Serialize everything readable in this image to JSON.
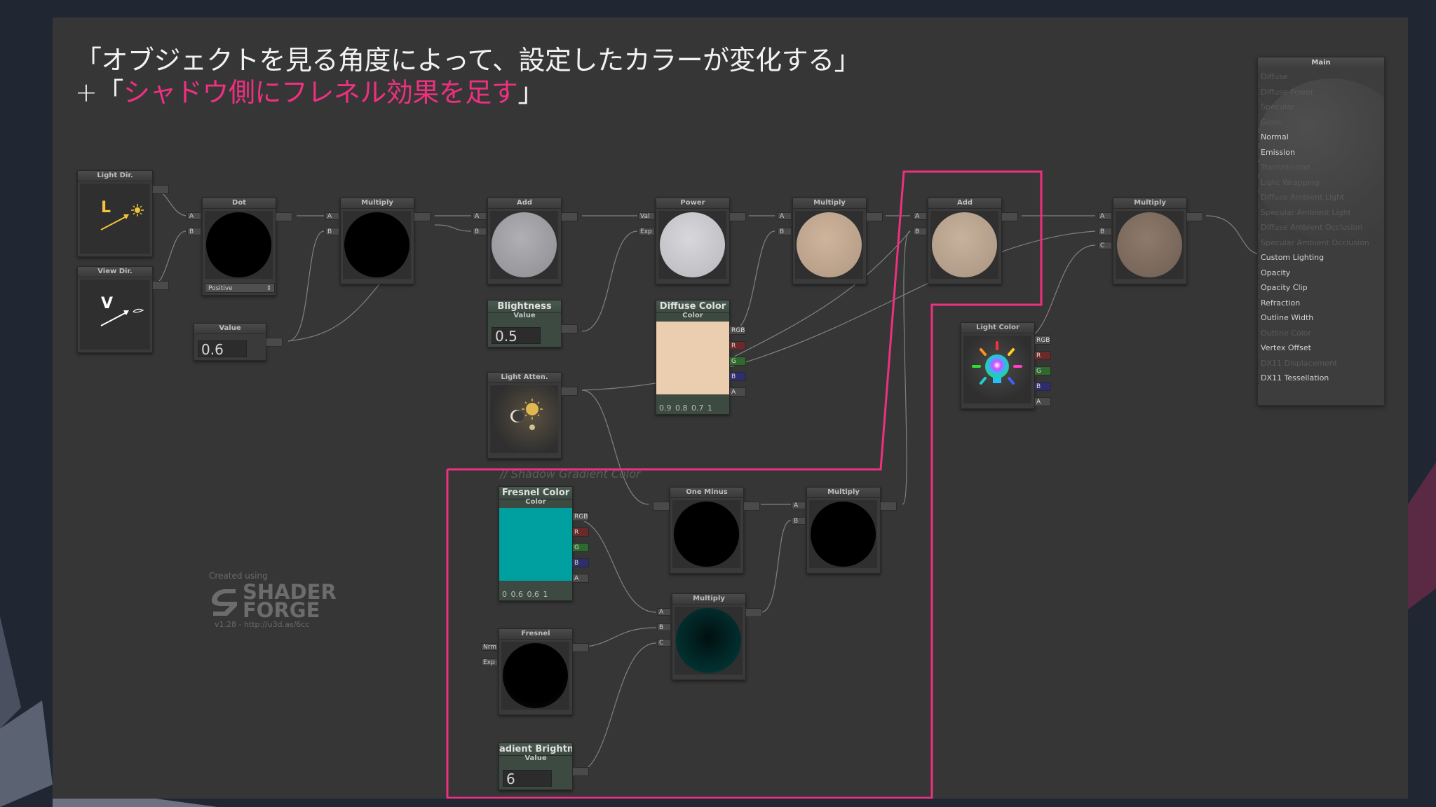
{
  "headline": {
    "line1": "「オブジェクトを見る角度によって、設定したカラーが変化する」",
    "line2_prefix": "+「",
    "line2_highlight": "シャドウ側にフレネル効果を足す",
    "line2_suffix": "」"
  },
  "nodes": {
    "light_dir": {
      "title": "Light Dir.",
      "glyph": "L"
    },
    "view_dir": {
      "title": "View Dir.",
      "glyph": "V"
    },
    "dot": {
      "title": "Dot",
      "port_a": "A",
      "port_b": "B",
      "mode": "Positive"
    },
    "value1": {
      "title": "Value",
      "value": "0.6"
    },
    "multiply1": {
      "title": "Multiply",
      "port_a": "A",
      "port_b": "B"
    },
    "add1": {
      "title": "Add",
      "port_a": "A",
      "port_b": "B"
    },
    "blightness": {
      "title": "Blightness",
      "sub": "Value",
      "value": "0.5"
    },
    "light_atten": {
      "title": "Light Atten."
    },
    "power": {
      "title": "Power",
      "port_val": "Val",
      "port_exp": "Exp"
    },
    "diffuse_color": {
      "title": "Diffuse Color",
      "sub": "Color",
      "swatch": "#ebcdb0",
      "rgba_text": "0.9  0.8  0.7  1",
      "ports": [
        "RGB",
        "R",
        "G",
        "B",
        "A"
      ]
    },
    "multiply2": {
      "title": "Multiply",
      "port_a": "A",
      "port_b": "B"
    },
    "add2": {
      "title": "Add",
      "port_a": "A",
      "port_b": "B"
    },
    "multiply3": {
      "title": "Multiply",
      "port_a": "A",
      "port_b": "B",
      "port_c": "C"
    },
    "light_color": {
      "title": "Light Color",
      "ports": [
        "RGB",
        "R",
        "G",
        "B",
        "A"
      ]
    },
    "fresnel_color": {
      "title": "Fresnel Color",
      "sub": "Color",
      "swatch": "#00a0a0",
      "rgba_text": "0   0.6  0.6  1",
      "ports": [
        "RGB",
        "R",
        "G",
        "B",
        "A"
      ]
    },
    "one_minus": {
      "title": "One Minus"
    },
    "multiply4": {
      "title": "Multiply",
      "port_a": "A",
      "port_b": "B"
    },
    "multiply5": {
      "title": "Multiply",
      "port_a": "A",
      "port_b": "B",
      "port_c": "C"
    },
    "fresnel": {
      "title": "Fresnel",
      "port_nrm": "Nrm",
      "port_exp": "Exp"
    },
    "gradient_brightness": {
      "title": "adient Brightne",
      "sub": "Value",
      "value": "6"
    }
  },
  "comment": "// Shadow Gradient Color",
  "main_panel": {
    "title": "Main",
    "inputs": [
      {
        "label": "Diffuse",
        "active": false
      },
      {
        "label": "Diffuse Power",
        "active": false
      },
      {
        "label": "Specular",
        "active": false
      },
      {
        "label": "Gloss",
        "active": false
      },
      {
        "label": "Normal",
        "active": true
      },
      {
        "label": "Emission",
        "active": true
      },
      {
        "label": "Transmission",
        "active": false
      },
      {
        "label": "Light Wrapping",
        "active": false
      },
      {
        "label": "Diffuse Ambient Light",
        "active": false
      },
      {
        "label": "Specular Ambient Light",
        "active": false
      },
      {
        "label": "Diffuse Ambient Occlusion",
        "active": false
      },
      {
        "label": "Specular Ambient Occlusion",
        "active": false
      },
      {
        "label": "Custom Lighting",
        "active": true
      },
      {
        "label": "Opacity",
        "active": true
      },
      {
        "label": "Opacity Clip",
        "active": true
      },
      {
        "label": "Refraction",
        "active": true
      },
      {
        "label": "Outline Width",
        "active": true
      },
      {
        "label": "Outline Color",
        "active": false
      },
      {
        "label": "Vertex Offset",
        "active": true
      },
      {
        "label": "DX11 Displacement",
        "active": false
      },
      {
        "label": "DX11 Tessellation",
        "active": true
      }
    ]
  },
  "credit": {
    "created_using": "Created using",
    "logo_line1": "SHADER",
    "logo_line2": "FORGE",
    "version": "v1.28 - http://u3d.as/6cc"
  },
  "colors": {
    "highlight_pink": "#ee3080",
    "background": "#202733",
    "canvas": "#363636"
  }
}
